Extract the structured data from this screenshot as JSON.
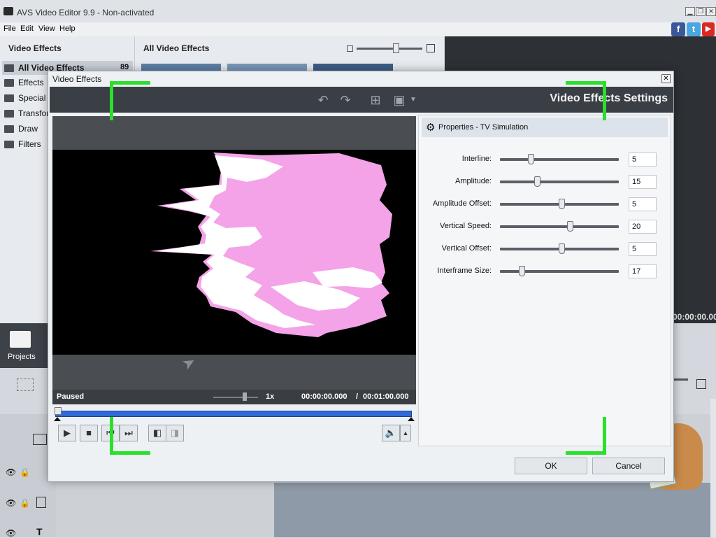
{
  "app": {
    "title": "AVS Video Editor 9.9 - Non-activated"
  },
  "window_controls": {
    "minimize": "▁",
    "restore": "❐",
    "close": "✕"
  },
  "menu": [
    "File",
    "Edit",
    "View",
    "Help"
  ],
  "social": {
    "facebook": "f",
    "twitter": "t",
    "youtube": "▶"
  },
  "left_panel": {
    "title": "Video Effects",
    "items": [
      {
        "label": "All Video Effects",
        "count": "89"
      },
      {
        "label": "Effects"
      },
      {
        "label": "Special"
      },
      {
        "label": "Transfor"
      },
      {
        "label": "Draw"
      },
      {
        "label": "Filters"
      }
    ]
  },
  "mid_panel": {
    "title": "All Video Effects"
  },
  "background": {
    "projects_label": "Projects",
    "timecode_fragment": "00:00:00.000"
  },
  "dialog": {
    "title": "Video Effects",
    "settings_title": "Video Effects Settings",
    "player": {
      "status": "Paused",
      "speed": "1x",
      "current_time": "00:00:00.000",
      "separator": "/",
      "total_time": "00:01:00.000"
    },
    "properties": {
      "header": "Properties - TV Simulation",
      "rows": [
        {
          "label": "Interline:",
          "value": "5",
          "level": 0.26
        },
        {
          "label": "Amplitude:",
          "value": "15",
          "level": 0.31
        },
        {
          "label": "Amplitude Offset:",
          "value": "5",
          "level": 0.52
        },
        {
          "label": "Vertical Speed:",
          "value": "20",
          "level": 0.59
        },
        {
          "label": "Vertical Offset:",
          "value": "5",
          "level": 0.52
        },
        {
          "label": "Interframe Size:",
          "value": "17",
          "level": 0.18
        }
      ]
    },
    "buttons": {
      "ok": "OK",
      "cancel": "Cancel"
    }
  },
  "icons": {
    "undo": "undo-icon",
    "redo": "redo-icon",
    "grid": "grid-icon",
    "monitor": "monitor-icon",
    "play": "play-icon",
    "stop": "stop-icon",
    "prev_frame": "prev-frame-icon",
    "next_frame": "next-frame-icon",
    "volume": "volume-icon",
    "settings": "gear-icon"
  },
  "colors": {
    "accent_green": "#29e02a",
    "seek_blue": "#2f6ad8",
    "effect_pink": "#f4a3e8"
  }
}
